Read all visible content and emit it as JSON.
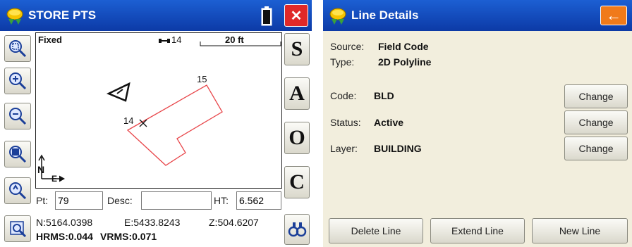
{
  "left_app": {
    "title": "STORE PTS",
    "close_label": "✕",
    "map": {
      "mode": "Fixed",
      "satellites": "14",
      "scale": "20 ft",
      "point_labels": [
        "15",
        "14"
      ],
      "north_label": "N",
      "east_label": "E"
    },
    "point_row": {
      "pt_label": "Pt:",
      "pt_value": "79",
      "desc_label": "Desc:",
      "desc_value": "",
      "ht_label": "HT:",
      "ht_value": "6.562"
    },
    "coords": {
      "n": "N:5164.0398",
      "e": "E:5433.8243",
      "z": "Z:504.6207",
      "hrms": "HRMS:0.044",
      "vrms": "VRMS:0.071"
    },
    "right_toolbar": [
      "S",
      "A",
      "O",
      "C"
    ],
    "icons": [
      "zoom-window-icon",
      "zoom-in-icon",
      "zoom-out-icon",
      "zoom-extents-icon",
      "zoom-previous-icon",
      "map-settings-icon",
      "search-points-icon",
      "battery-icon"
    ],
    "line_color": "#e8464a"
  },
  "right_app": {
    "title": "Line Details",
    "back_label": "←",
    "source_label": "Source:",
    "source_value": "Field Code",
    "type_label": "Type:",
    "type_value": "2D Polyline",
    "rows": [
      {
        "label": "Code:",
        "value": "BLD",
        "button": "Change"
      },
      {
        "label": "Status:",
        "value": "Active",
        "button": "Change"
      },
      {
        "label": "Layer:",
        "value": "BUILDING",
        "button": "Change"
      }
    ],
    "bottom_buttons": [
      "Delete Line",
      "Extend Line",
      "New Line"
    ],
    "accent": "#f07a1a"
  }
}
